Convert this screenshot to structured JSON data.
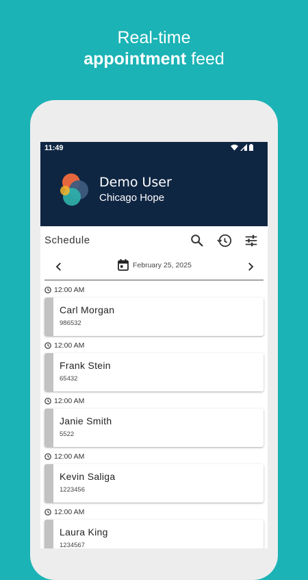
{
  "colors": {
    "teal": "#1bb3b5",
    "navy": "#0f2643",
    "card_bar": "#c2c2c2"
  },
  "promo": {
    "line1": "Real-time",
    "line2_bold": "appointment",
    "line2_rest": " feed"
  },
  "status_bar": {
    "time": "11:49",
    "icons": [
      "wifi-icon",
      "cell-signal-icon",
      "battery-icon"
    ]
  },
  "header": {
    "user_name": "Demo User",
    "organization": "Chicago Hope"
  },
  "toolbar": {
    "title": "Schedule",
    "actions": [
      "search-icon",
      "history-icon",
      "filter-icon"
    ]
  },
  "date_nav": {
    "date": "February 25, 2025"
  },
  "appointments": [
    {
      "time": "12:00 AM",
      "name": "Carl Morgan",
      "id": "986532"
    },
    {
      "time": "12:00 AM",
      "name": "Frank Stein",
      "id": "65432"
    },
    {
      "time": "12:00 AM",
      "name": "Janie Smith",
      "id": "5522"
    },
    {
      "time": "12:00 AM",
      "name": "Kevin Saliga",
      "id": "1223456"
    },
    {
      "time": "12:00 AM",
      "name": "Laura King",
      "id": "1234567"
    }
  ]
}
